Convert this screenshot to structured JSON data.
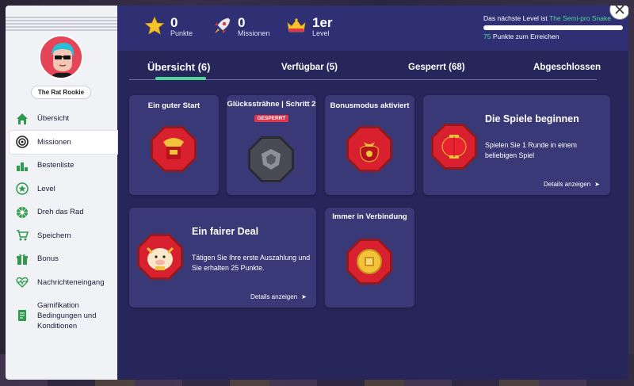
{
  "colors": {
    "accent": "#4fd59a",
    "locked": "#e3334a",
    "header_bg": "#2f3073",
    "content_bg": "#26265a",
    "card_bg": "#383976",
    "badge_red": "#d8202f"
  },
  "sidebar": {
    "rank": "The Rat Rookie",
    "items": [
      {
        "label": "Übersicht",
        "icon": "home-icon"
      },
      {
        "label": "Missionen",
        "icon": "target-icon"
      },
      {
        "label": "Bestenliste",
        "icon": "podium-icon"
      },
      {
        "label": "Level",
        "icon": "star-badge-icon"
      },
      {
        "label": "Dreh das Rad",
        "icon": "wheel-icon"
      },
      {
        "label": "Speichern",
        "icon": "cart-icon"
      },
      {
        "label": "Bonus",
        "icon": "gift-icon"
      },
      {
        "label": "Nachrichteneingang",
        "icon": "heartbeat-icon"
      },
      {
        "label": "Gamifikation Bedingungen und Konditionen",
        "icon": "document-icon"
      }
    ]
  },
  "header": {
    "points_value": "0",
    "points_label": "Punkte",
    "missions_value": "0",
    "missions_label": "Missionen",
    "level_value": "1er",
    "level_label": "Level",
    "next_level_prefix": "Das nächste Level ist ",
    "next_level_name": "The Semi-pro Snake",
    "progress_fraction": 0.0,
    "points_needed": "75",
    "points_needed_suffix": " Punkte zum Erreichen"
  },
  "tabs": [
    {
      "label": "Übersicht (6)"
    },
    {
      "label": "Verfügbar (5)"
    },
    {
      "label": "Gesperrt (68)"
    },
    {
      "label": "Abgeschlossen"
    }
  ],
  "cards": {
    "c1": {
      "title": "Ein guter Start"
    },
    "c2": {
      "title": "Glückssträhne | Schritt 2",
      "tag": "GESPERRT"
    },
    "c3": {
      "title": "Bonusmodus aktiviert"
    },
    "c4": {
      "title": "Die Spiele beginnen",
      "desc": "Spielen Sie 1 Runde in einem beliebigen Spiel",
      "link": "Details anzeigen"
    },
    "c5": {
      "title": "Ein fairer Deal",
      "desc": "Tätigen Sie Ihre erste Auszahlung und Sie erhalten 25 Punkte.",
      "link": "Details anzeigen"
    },
    "c6": {
      "title": "Immer in Verbindung"
    }
  }
}
